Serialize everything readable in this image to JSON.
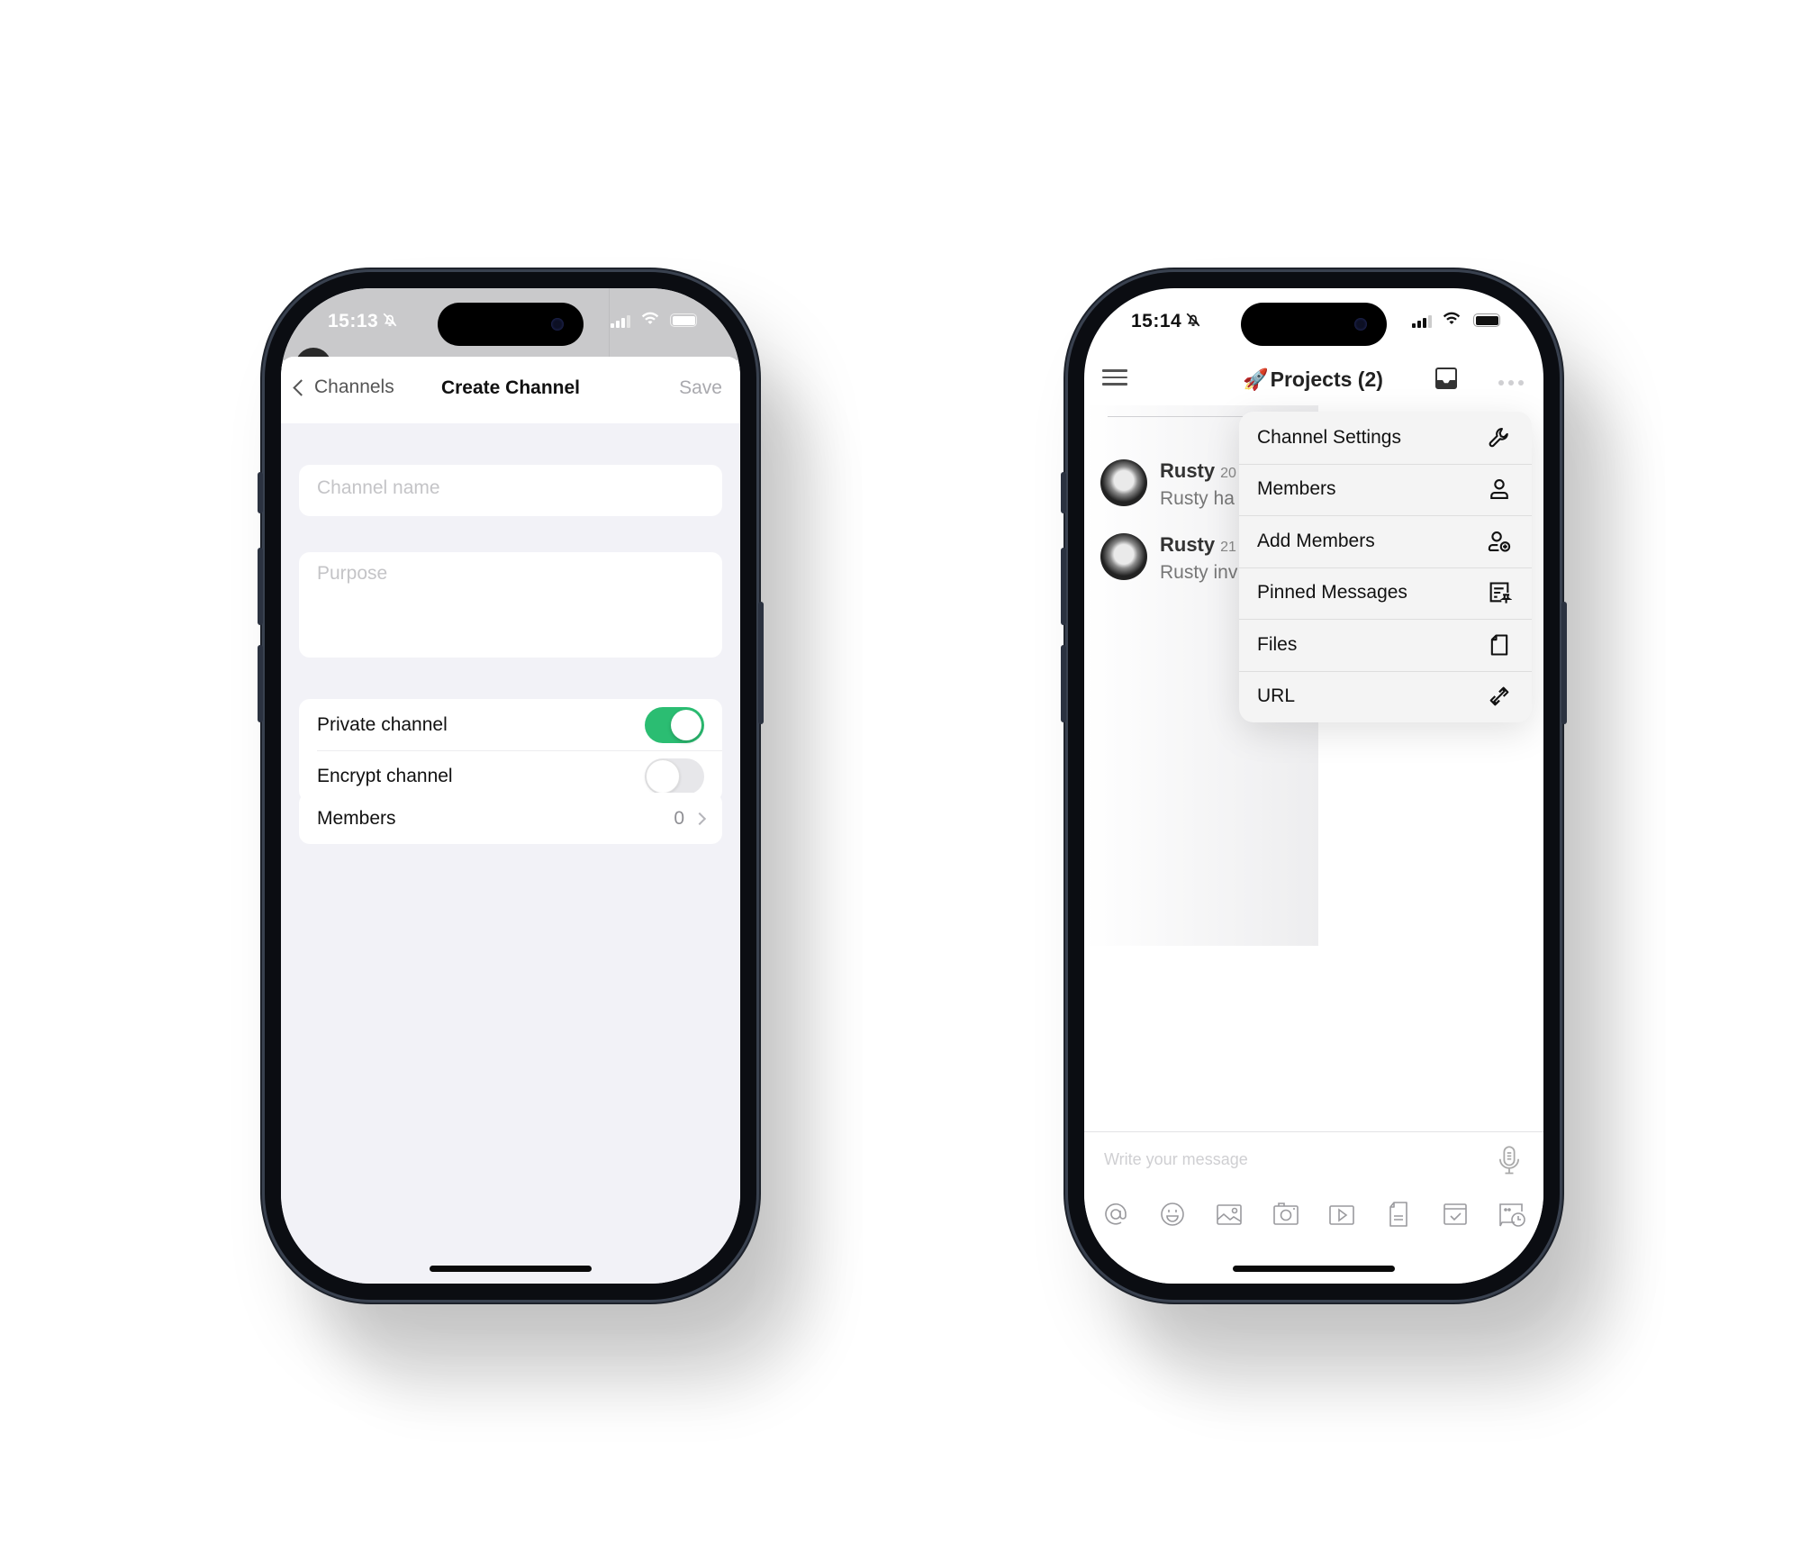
{
  "left_phone": {
    "status": {
      "time": "15:13",
      "muted": true
    },
    "nav": {
      "back_label": "Channels",
      "title": "Create Channel",
      "save_label": "Save"
    },
    "form": {
      "channel_name": {
        "value": "",
        "placeholder": "Channel name"
      },
      "purpose": {
        "value": "",
        "placeholder": "Purpose"
      }
    },
    "toggles": [
      {
        "label": "Private channel",
        "on": true
      },
      {
        "label": "Encrypt channel",
        "on": false
      }
    ],
    "members": {
      "label": "Members",
      "count": "0"
    },
    "colors": {
      "toggle_on": "#2bbd72",
      "background": "#f2f2f7"
    }
  },
  "right_phone": {
    "status": {
      "time": "15:14",
      "muted": true
    },
    "header": {
      "emoji": "🚀",
      "title": "Projects (2)"
    },
    "messages": [
      {
        "author": "Rusty",
        "timestamp": "20",
        "text": "Rusty ha"
      },
      {
        "author": "Rusty",
        "timestamp": "21",
        "text": "Rusty inv"
      }
    ],
    "menu": [
      {
        "label": "Channel Settings",
        "icon": "wrench-icon"
      },
      {
        "label": "Members",
        "icon": "user-icon"
      },
      {
        "label": "Add Members",
        "icon": "user-add-icon"
      },
      {
        "label": "Pinned Messages",
        "icon": "pinned-note-icon"
      },
      {
        "label": "Files",
        "icon": "file-icon"
      },
      {
        "label": "URL",
        "icon": "link-icon"
      }
    ],
    "composer": {
      "value": "",
      "placeholder": "Write your message",
      "tools": [
        "at-mention-icon",
        "emoji-icon",
        "image-icon",
        "camera-icon",
        "video-icon",
        "document-icon",
        "task-icon",
        "scheduled-message-icon"
      ]
    }
  }
}
